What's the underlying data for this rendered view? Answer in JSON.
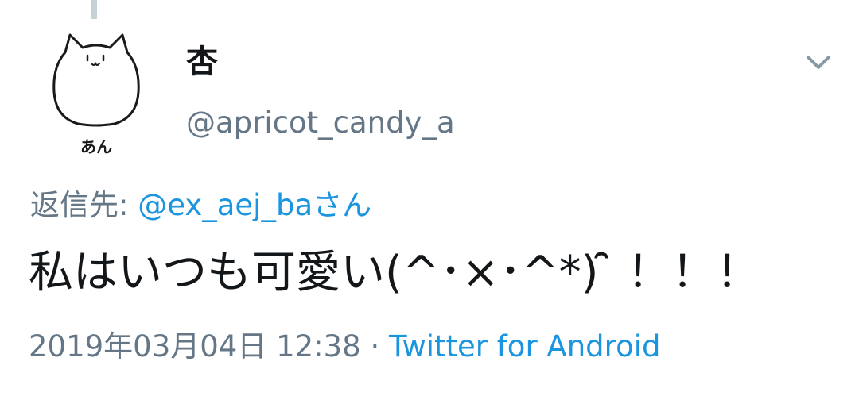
{
  "user": {
    "display_name": "杏",
    "handle": "@apricot_candy_a",
    "avatar_label": "あん"
  },
  "reply": {
    "prefix": "返信先: ",
    "mention": "@ex_aej_ba",
    "suffix": "さん"
  },
  "tweet": {
    "text": "私はいつも可愛い(^･×･^*) ̑̑ ！！！"
  },
  "meta": {
    "timestamp": "2019年03月04日 12:38",
    "separator": " · ",
    "source": "Twitter for Android"
  },
  "icons": {
    "menu": "chevron-down-icon",
    "avatar": "cat-avatar"
  },
  "colors": {
    "text": "#14171a",
    "secondary": "#657786",
    "link": "#1b95e0",
    "thread_line": "#c6d0d7"
  }
}
